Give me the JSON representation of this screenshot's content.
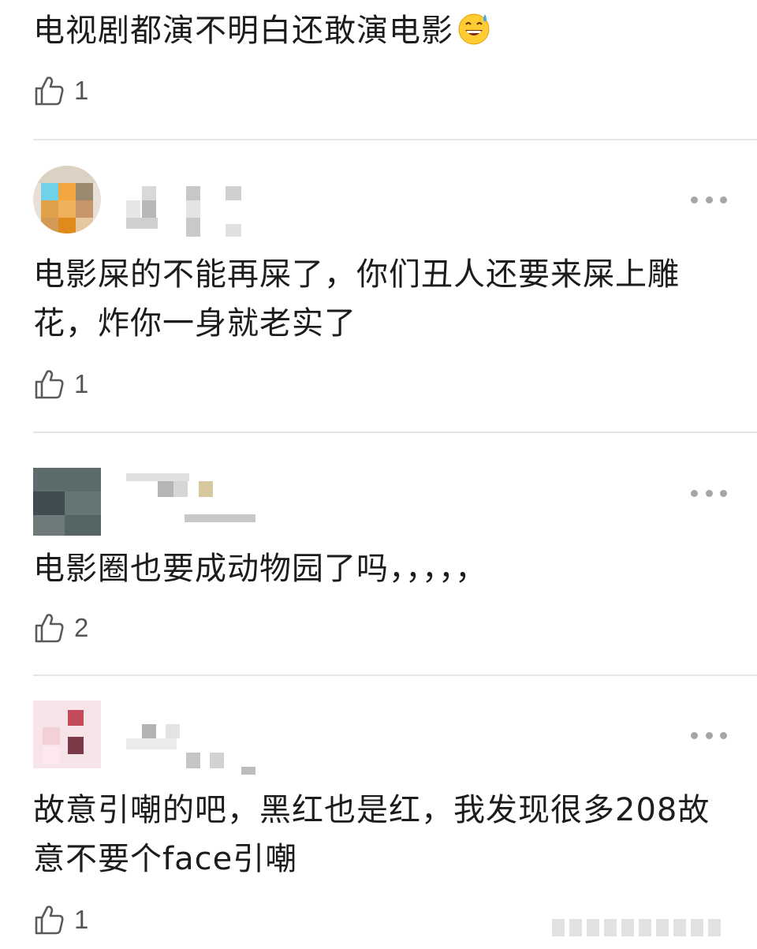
{
  "comments": [
    {
      "text": "电视剧都演不明白还敢演电影",
      "emoji": "grinning-sweat-emoji",
      "likes": "1"
    },
    {
      "text": "电影屎的不能再屎了，你们丑人还要来屎上雕花，炸你一身就老实了",
      "likes": "1"
    },
    {
      "text": "电影圈也要成动物园了吗，，，，，",
      "likes": "2"
    },
    {
      "text": "故意引嘲的吧，黑红也是红，我发现很多208故意不要个face引嘲",
      "likes": "1"
    }
  ],
  "icons": {
    "like": "thumbs-up-icon",
    "more": "more-options-icon"
  },
  "colors": {
    "text": "#1c1c1c",
    "count": "#555555",
    "divider": "#e6e6e6",
    "more_dots": "#a6a6a6"
  }
}
